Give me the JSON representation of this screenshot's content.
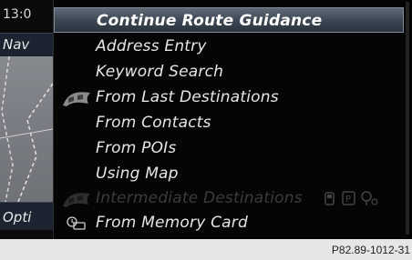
{
  "status_strip": {
    "clock": "13:0",
    "nav_label": "Nav",
    "options_label": "Opti"
  },
  "menu": {
    "items": [
      {
        "label": "Continue Route Guidance",
        "state": "selected",
        "icon": ""
      },
      {
        "label": "Address Entry",
        "state": "normal",
        "icon": ""
      },
      {
        "label": "Keyword Search",
        "state": "normal",
        "icon": ""
      },
      {
        "label": "From Last Destinations",
        "state": "normal",
        "icon": "checkered-flag-icon"
      },
      {
        "label": "From Contacts",
        "state": "normal",
        "icon": ""
      },
      {
        "label": "From POIs",
        "state": "normal",
        "icon": ""
      },
      {
        "label": "Using Map",
        "state": "normal",
        "icon": ""
      },
      {
        "label": "Intermediate Destinations",
        "state": "disabled",
        "icon": "checkered-flag-icon"
      },
      {
        "label": "From Memory Card",
        "state": "normal",
        "icon": "memory-card-icon"
      }
    ],
    "intermediate_trailing_icons": [
      "fuel-icon",
      "parking-icon",
      "tree-icon"
    ]
  },
  "caption": "P82.89-1012-31",
  "colors": {
    "screen_bg": "#000000",
    "selection_bg": "#3b4652",
    "text": "#e6e6e6",
    "disabled_text": "#3b3b3b"
  }
}
